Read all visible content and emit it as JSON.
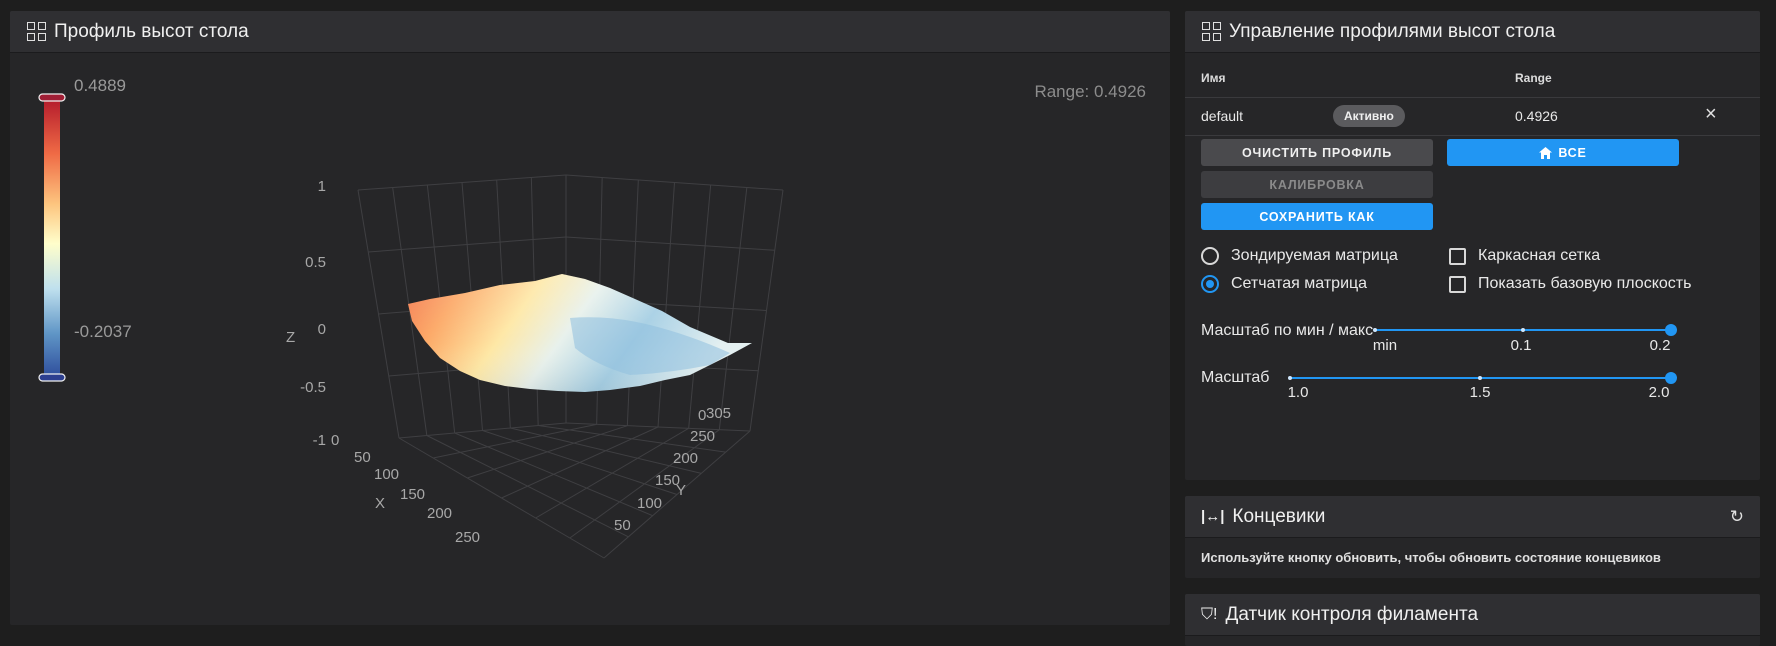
{
  "bed_mesh_panel": {
    "title": "Профиль высот стола",
    "range_label": "Range: 0.4926",
    "colorbar": {
      "max": "0.4889",
      "min": "-0.2037"
    }
  },
  "chart_data": {
    "type": "surface",
    "title": "",
    "z_axis": {
      "label": "Z",
      "ticks": [
        "1",
        "0.5",
        "0",
        "-0.5",
        "-1"
      ],
      "range": [
        -1,
        1
      ]
    },
    "x_axis": {
      "label": "X",
      "ticks": [
        "0",
        "50",
        "100",
        "150",
        "200",
        "250",
        "305"
      ]
    },
    "y_axis": {
      "label": "Y",
      "ticks": [
        "0",
        "50",
        "100",
        "150",
        "200",
        "250",
        "305"
      ]
    },
    "z_min": -0.2037,
    "z_max": 0.4889,
    "colors": {
      "high": "#b2182b",
      "mid": "#fffecb",
      "low": "#2c4a9a"
    }
  },
  "profiles_panel": {
    "title": "Управление профилями высот стола",
    "col_name": "Имя",
    "col_range": "Range",
    "row": {
      "name": "default",
      "badge": "Активно",
      "range": "0.4926"
    },
    "buttons": {
      "clear": "Очистить профиль",
      "home_all": "Все",
      "calibrate": "Калибровка",
      "save_as": "Сохранить как"
    },
    "options": {
      "probed": "Зондируемая матрица",
      "mesh": "Сетчатая матрица",
      "wireframe": "Каркасная сетка",
      "base_plane": "Показать базовую плоскость"
    },
    "scale_minmax": {
      "label": "Масштаб по мин / макс",
      "ticks": [
        "min",
        "0.1",
        "0.2"
      ],
      "value": "0.2"
    },
    "scale": {
      "label": "Масштаб",
      "ticks": [
        "1.0",
        "1.5",
        "2.0"
      ],
      "value": "2.0"
    }
  },
  "endstops_panel": {
    "title": "Концевики",
    "message": "Используйте кнопку обновить, чтобы обновить состояние концевиков"
  },
  "filament_panel": {
    "title": "Датчик контроля филамента"
  },
  "accent": "#2196f3"
}
